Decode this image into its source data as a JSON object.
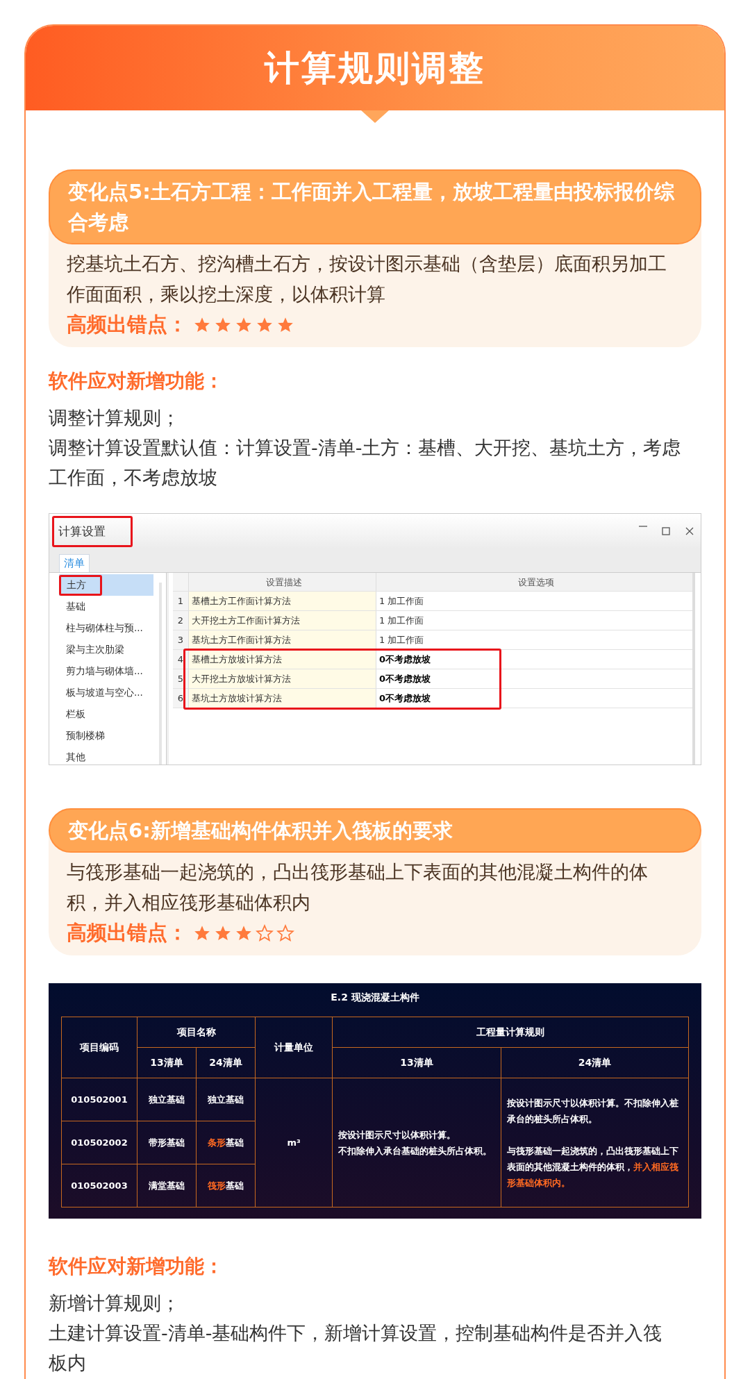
{
  "header": {
    "title": "计算规则调整"
  },
  "sections": [
    {
      "kind": "change",
      "title": "变化点5:土石方工程：工作面并入工程量，放坡工程量由投标报价综合考虑",
      "description": "挖基坑土石方、挖沟槽土石方，按设计图示基础（含垫层）底面积另加工作面面积，乘以挖土深度，以体积计算",
      "rating_label": "高频出错点：",
      "stars": 5
    },
    {
      "kind": "feature",
      "heading": "软件应对新增功能：",
      "lines": [
        "调整计算规则；",
        "调整计算设置默认值：计算设置-清单-土方：基槽、大开挖、基坑土方，考虑工作面，不考虑放坡"
      ]
    },
    {
      "kind": "settings_window",
      "title": "计算设置",
      "title_highlighted": true,
      "tabs": [
        {
          "label": "清单",
          "selected": true
        }
      ],
      "categories": [
        {
          "label": "土方",
          "selected": true,
          "highlighted": true
        },
        {
          "label": "基础",
          "selected": false,
          "highlighted": false
        },
        {
          "label": "柱与砌体柱与预...",
          "selected": false,
          "highlighted": false
        },
        {
          "label": "梁与主次肋梁",
          "selected": false,
          "highlighted": false
        },
        {
          "label": "剪力墙与砌体墙...",
          "selected": false,
          "highlighted": false
        },
        {
          "label": "板与坡道与空心...",
          "selected": false,
          "highlighted": false
        },
        {
          "label": "栏板",
          "selected": false,
          "highlighted": false
        },
        {
          "label": "预制楼梯",
          "selected": false,
          "highlighted": false
        },
        {
          "label": "其他",
          "selected": false,
          "highlighted": false
        }
      ],
      "columns": [
        "设置描述",
        "设置选项"
      ],
      "rows": [
        {
          "number": "1",
          "description": "基槽土方工作面计算方法",
          "value": "1 加工作面",
          "highlighted": false
        },
        {
          "number": "2",
          "description": "大开挖土方工作面计算方法",
          "value": "1 加工作面",
          "highlighted": false
        },
        {
          "number": "3",
          "description": "基坑土方工作面计算方法",
          "value": "1 加工作面",
          "highlighted": false
        },
        {
          "number": "4",
          "description": "基槽土方放坡计算方法",
          "value": "0不考虑放坡",
          "highlighted": true
        },
        {
          "number": "5",
          "description": "大开挖土方放坡计算方法",
          "value": "0不考虑放坡",
          "highlighted": true
        },
        {
          "number": "6",
          "description": "基坑土方放坡计算方法",
          "value": "0不考虑放坡",
          "highlighted": true
        }
      ]
    },
    {
      "kind": "change",
      "title": "变化点6:新增基础构件体积并入筏板的要求",
      "description": "与筏形基础一起浇筑的，凸出筏形基础上下表面的其他混凝土构件的体积，并入相应筏形基础体积内",
      "rating_label": "高频出错点：",
      "stars": 3
    },
    {
      "kind": "spec_table",
      "title": "E.2 现浇混凝土构件",
      "header": {
        "code": "项目编码",
        "name": "项目名称",
        "name_13": "13清单",
        "name_24": "24清单",
        "unit": "计量单位",
        "rules": "工程量计算规则",
        "rules_13": "13清单",
        "rules_24": "24清单"
      },
      "rows": [
        {
          "code": "010502001",
          "name_13": "独立基础",
          "name_24": [
            {
              "text": "独立基础",
              "changed": false
            }
          ]
        },
        {
          "code": "010502002",
          "name_13": "带形基础",
          "name_24": [
            {
              "text": "条形",
              "changed": true
            },
            {
              "text": "基础",
              "changed": false
            }
          ]
        },
        {
          "code": "010502003",
          "name_13": "满堂基础",
          "name_24": [
            {
              "text": "筏形",
              "changed": true
            },
            {
              "text": "基础",
              "changed": false
            }
          ]
        }
      ],
      "unit": "m³",
      "rule_13": [
        "按设计图示尺寸以体积计算。",
        "不扣除伸入承台基础的桩头所占体积。"
      ],
      "rule_24": [
        [
          {
            "text": "按设计图示尺寸以体积计算。不扣除伸入桩承台的桩头所占体积。",
            "changed": false
          }
        ],
        [
          {
            "text": "与筏形基础一起浇筑的，凸出筏形基础上下表面的其他混凝土构件的体积，",
            "changed": false
          },
          {
            "text": "并入相应筏形基础体积内。",
            "changed": true
          }
        ]
      ]
    },
    {
      "kind": "feature",
      "heading": "软件应对新增功能：",
      "lines": [
        "新增计算规则；",
        "土建计算设置-清单-基础构件下，新增计算设置，控制基础构件是否并入筏板内"
      ]
    }
  ]
}
